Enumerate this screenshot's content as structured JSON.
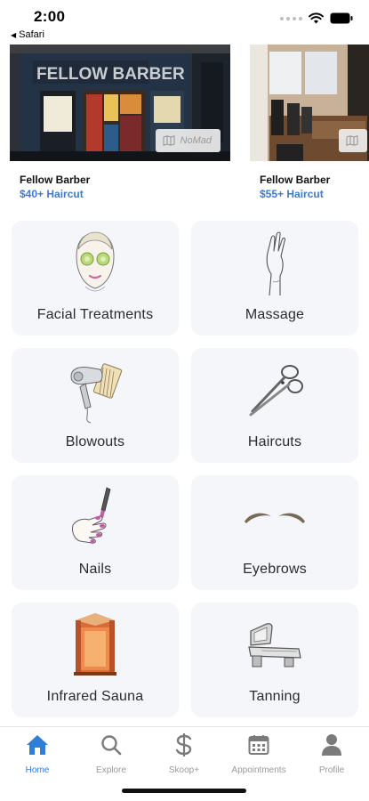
{
  "status_bar": {
    "time": "2:00",
    "back_app": "Safari"
  },
  "featured": [
    {
      "name": "Fellow Barber",
      "price": "$40+ Haircut",
      "storefront_sign": "FELLOW BARBER",
      "neighborhood": "NoMad"
    },
    {
      "name": "Fellow Barber",
      "price": "$55+ Haircut"
    }
  ],
  "categories": [
    {
      "label": "Facial Treatments",
      "icon": "face-mask-icon"
    },
    {
      "label": "Massage",
      "icon": "hand-icon"
    },
    {
      "label": "Blowouts",
      "icon": "hair-dryer-icon"
    },
    {
      "label": "Haircuts",
      "icon": "scissors-icon"
    },
    {
      "label": "Nails",
      "icon": "nail-polish-icon"
    },
    {
      "label": "Eyebrows",
      "icon": "eyebrows-icon"
    },
    {
      "label": "Infrared Sauna",
      "icon": "sauna-icon"
    },
    {
      "label": "Tanning",
      "icon": "tanning-bed-icon"
    }
  ],
  "tab_bar": {
    "active_color": "#2f7fd6",
    "inactive_color": "#9a9a9a",
    "tabs": [
      {
        "label": "Home",
        "icon": "home-icon",
        "active": true
      },
      {
        "label": "Explore",
        "icon": "search-icon",
        "active": false
      },
      {
        "label": "Skoop+",
        "icon": "dollar-icon",
        "active": false
      },
      {
        "label": "Appointments",
        "icon": "calendar-icon",
        "active": false
      },
      {
        "label": "Profile",
        "icon": "person-icon",
        "active": false
      }
    ]
  }
}
